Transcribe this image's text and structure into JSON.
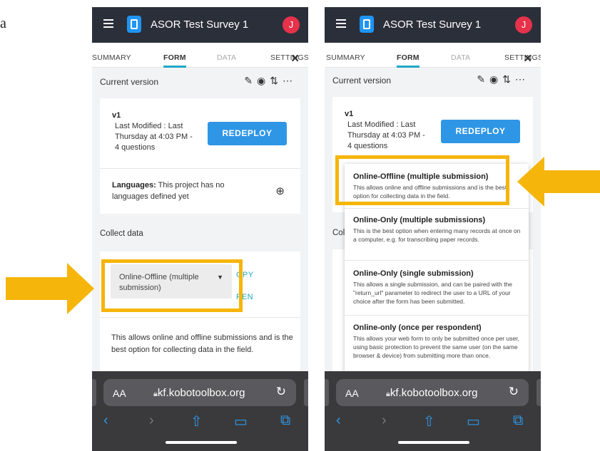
{
  "figure_label": "a",
  "colors": {
    "accent": "#2f96e6",
    "highlight": "#f5b50a",
    "link": "#1ea7c6",
    "avatar": "#e6324a",
    "topbar": "#2b2f3a"
  },
  "app": {
    "title": "ASOR Test Survey 1",
    "avatar_initial": "J",
    "menu_icon": "hamburger-menu-icon",
    "logo_icon": "kobo-logo-icon"
  },
  "tabs": [
    {
      "label": "SUMMARY",
      "active": false
    },
    {
      "label": "FORM",
      "active": true
    },
    {
      "label": "DATA",
      "active": false
    },
    {
      "label": "SETTINGS",
      "active": false
    }
  ],
  "current_version": {
    "label": "Current version",
    "icons": [
      "pencil-icon",
      "eye-icon",
      "deploy-icon",
      "more-icon"
    ]
  },
  "version": {
    "name": "v1",
    "modified": "Last Modified : Last Thursday at 4:03 PM - 4 questions",
    "redeploy_label": "REDEPLOY"
  },
  "languages": {
    "label": "Languages:",
    "text": "This project has no languages defined yet",
    "icon": "globe-icon"
  },
  "collect": {
    "label": "Collect data",
    "left_label": "Collect data",
    "right_label": "Col",
    "selected": "Online-Offline (multiple submission)",
    "copy_label": "COPY",
    "open_label": "OPEN",
    "copy_visible": "OPY",
    "open_visible": "PEN",
    "description": "This allows online and offline submissions and is the best option for collecting data in the field."
  },
  "options": [
    {
      "title": "Online-Offline (multiple submission)",
      "desc": "This allows online and offline submissions and is the best option for collecting data in the field."
    },
    {
      "title": "Online-Only (multiple submissions)",
      "desc": "This is the best option when entering many records at once on a computer, e.g. for transcribing paper records."
    },
    {
      "title": "Online-Only (single submission)",
      "desc": "This allows a single submission, and can be paired with the \"return_url\" parameter to redirect the user to a URL of your choice after the form has been submitted."
    },
    {
      "title": "Online-only (once per respondent)",
      "desc": "This allows your web form to only be submitted once per user, using basic protection to prevent the same user (on the same browser & device) from submitting more than once."
    }
  ],
  "browser": {
    "aa_label": "AA",
    "url": "kf.kobotoolbox.org",
    "icons": [
      "back-icon",
      "forward-icon",
      "share-icon",
      "bookmarks-icon",
      "tabs-icon",
      "lock-icon",
      "reload-icon"
    ]
  }
}
